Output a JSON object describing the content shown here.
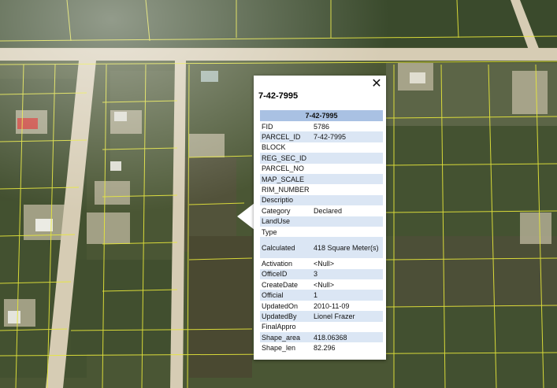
{
  "popup": {
    "title": "7-42-7995",
    "close_icon": "close-icon",
    "table_header": "7-42-7995",
    "attributes": [
      {
        "key": "FID",
        "value": "5786"
      },
      {
        "key": "PARCEL_ID",
        "value": "7-42-7995"
      },
      {
        "key": "BLOCK",
        "value": ""
      },
      {
        "key": "REG_SEC_ID",
        "value": ""
      },
      {
        "key": "PARCEL_NO",
        "value": ""
      },
      {
        "key": "MAP_SCALE",
        "value": ""
      },
      {
        "key": "RIM_NUMBER",
        "value": ""
      },
      {
        "key": "Descriptio",
        "value": ""
      },
      {
        "key": "Category",
        "value": "Declared"
      },
      {
        "key": "LandUse",
        "value": ""
      },
      {
        "key": "Type",
        "value": ""
      },
      {
        "key": "Calculated",
        "value": "418 Square Meter(s)"
      },
      {
        "key": "Activation",
        "value": "<Null>"
      },
      {
        "key": "OfficeID",
        "value": "3"
      },
      {
        "key": "CreateDate",
        "value": "<Null>"
      },
      {
        "key": "Official",
        "value": "1"
      },
      {
        "key": "UpdatedOn",
        "value": "2010-11-09"
      },
      {
        "key": "UpdatedBy",
        "value": "Lionel Frazer"
      },
      {
        "key": "FinalAppro",
        "value": ""
      },
      {
        "key": "Shape_area",
        "value": "418.06368"
      },
      {
        "key": "Shape_len",
        "value": "82.296"
      }
    ]
  },
  "colors": {
    "header_bg": "#a9c1e3",
    "row_alt_bg": "#dbe6f4",
    "parcel_line": "#e8e83a",
    "road": "#d8cfb8"
  }
}
